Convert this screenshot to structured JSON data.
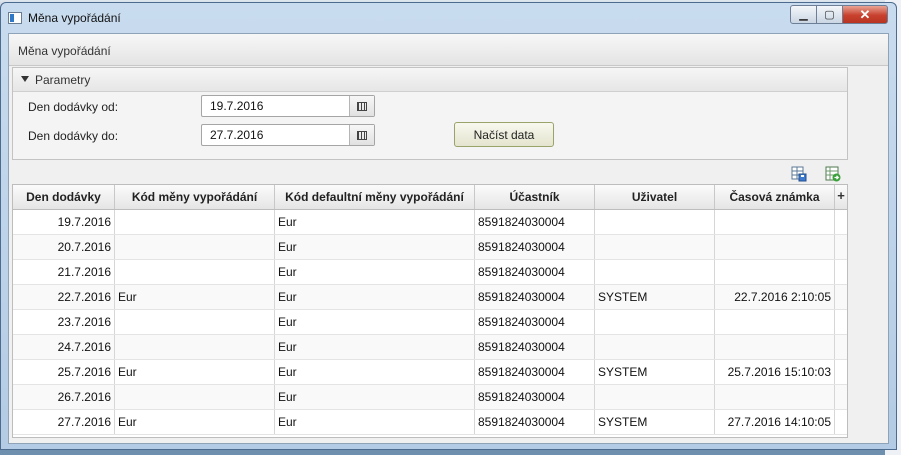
{
  "window": {
    "title": "Měna vypořádání",
    "minimize_glyph": "▁",
    "maximize_glyph": "▢",
    "close_glyph": "✕"
  },
  "main_header": {
    "title": "Měna vypořádání"
  },
  "parameters": {
    "title": "Parametry",
    "date_from_label": "Den dodávky od:",
    "date_from_value": "19.7.2016",
    "date_to_label": "Den dodávky do:",
    "date_to_value": "27.7.2016",
    "load_button_label": "Načíst data"
  },
  "toolbar": {
    "icons": [
      "table-save-icon",
      "excel-export-icon"
    ]
  },
  "table": {
    "columns": [
      "Den dodávky",
      "Kód měny vypořádání",
      "Kód defaultní měny vypořádání",
      "Účastník",
      "Uživatel",
      "Časová známka"
    ],
    "add_column_label": "+",
    "rows": [
      [
        "19.7.2016",
        "",
        "Eur",
        "8591824030004",
        "",
        ""
      ],
      [
        "20.7.2016",
        "",
        "Eur",
        "8591824030004",
        "",
        ""
      ],
      [
        "21.7.2016",
        "",
        "Eur",
        "8591824030004",
        "",
        ""
      ],
      [
        "22.7.2016",
        "Eur",
        "Eur",
        "8591824030004",
        "SYSTEM",
        "22.7.2016 2:10:05"
      ],
      [
        "23.7.2016",
        "",
        "Eur",
        "8591824030004",
        "",
        ""
      ],
      [
        "24.7.2016",
        "",
        "Eur",
        "8591824030004",
        "",
        ""
      ],
      [
        "25.7.2016",
        "Eur",
        "Eur",
        "8591824030004",
        "SYSTEM",
        "25.7.2016 15:10:03"
      ],
      [
        "26.7.2016",
        "",
        "Eur",
        "8591824030004",
        "",
        ""
      ],
      [
        "27.7.2016",
        "Eur",
        "Eur",
        "8591824030004",
        "SYSTEM",
        "27.7.2016 14:10:05"
      ]
    ]
  },
  "colors": {
    "title_bar": "#c9dcef",
    "close_button": "#c7412e",
    "panel_background": "#f0f0f0",
    "load_button_border": "#9aa36a"
  }
}
